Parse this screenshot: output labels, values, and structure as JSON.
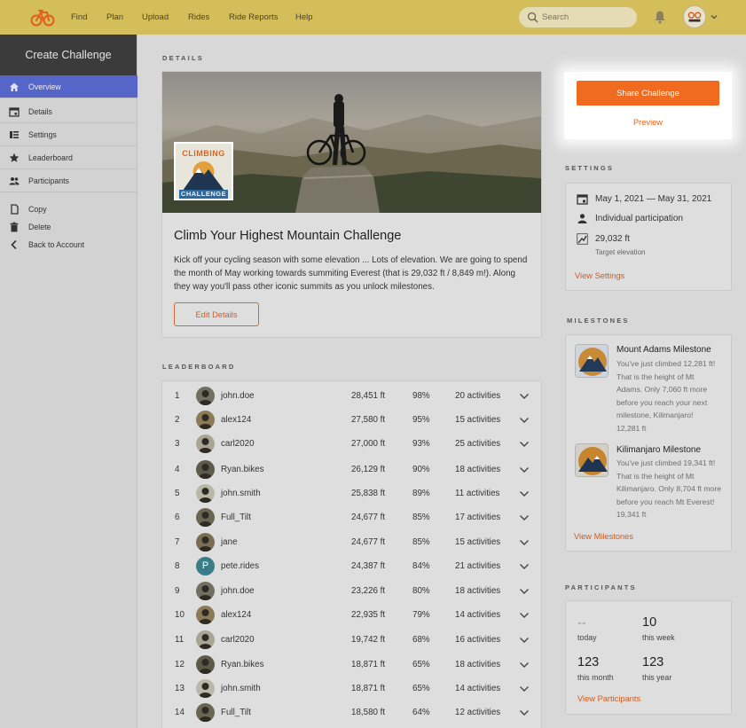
{
  "nav": {
    "items": [
      "Find",
      "Plan",
      "Upload",
      "Rides",
      "Ride Reports",
      "Help"
    ],
    "search_placeholder": "Search"
  },
  "sidebar": {
    "title": "Create Challenge",
    "items": [
      {
        "label": "Overview",
        "icon": "home-icon",
        "active": true
      },
      {
        "label": "Details",
        "icon": "calendar-icon"
      },
      {
        "label": "Settings",
        "icon": "settings-list-icon"
      },
      {
        "label": "Leaderboard",
        "icon": "star-icon"
      },
      {
        "label": "Participants",
        "icon": "people-icon"
      }
    ],
    "secondary": [
      {
        "label": "Copy",
        "icon": "copy-icon"
      },
      {
        "label": "Delete",
        "icon": "trash-icon"
      },
      {
        "label": "Back to Account",
        "icon": "chevron-left-icon"
      }
    ]
  },
  "details": {
    "section_label": "DETAILS",
    "badge_top": "CLIMBING",
    "badge_bottom": "CHALLENGE",
    "title": "Climb Your Highest Mountain Challenge",
    "description": "Kick off your cycling season with some elevation ... Lots of elevation. We are going to spend the month of May working towards summiting Everest (that is 29,032 ft / 8,849 m!). Along they way you'll pass other iconic summits as you unlock milestones.",
    "edit_label": "Edit Details"
  },
  "leaderboard": {
    "section_label": "LEADERBOARD",
    "rows": [
      {
        "rank": "1",
        "name": "john.doe",
        "elevation": "28,451 ft",
        "percent": "98%",
        "activities": "20 activities"
      },
      {
        "rank": "2",
        "name": "alex124",
        "elevation": "27,580 ft",
        "percent": "95%",
        "activities": "15 activities"
      },
      {
        "rank": "3",
        "name": "carl2020",
        "elevation": "27,000 ft",
        "percent": "93%",
        "activities": "25 activities"
      },
      {
        "rank": "4",
        "name": "Ryan.bikes",
        "elevation": "26,129 ft",
        "percent": "90%",
        "activities": "18 activities"
      },
      {
        "rank": "5",
        "name": "john.smith",
        "elevation": "25,838 ft",
        "percent": "89%",
        "activities": "11 activities"
      },
      {
        "rank": "6",
        "name": "Full_Tilt",
        "elevation": "24,677 ft",
        "percent": "85%",
        "activities": "17 activities"
      },
      {
        "rank": "7",
        "name": "jane",
        "elevation": "24,677 ft",
        "percent": "85%",
        "activities": "15 activities"
      },
      {
        "rank": "8",
        "name": "pete.rides",
        "elevation": "24,387 ft",
        "percent": "84%",
        "activities": "21 activities",
        "initial": "P"
      },
      {
        "rank": "9",
        "name": "john.doe",
        "elevation": "23,226 ft",
        "percent": "80%",
        "activities": "18 activities"
      },
      {
        "rank": "10",
        "name": "alex124",
        "elevation": "22,935 ft",
        "percent": "79%",
        "activities": "14 activities"
      },
      {
        "rank": "11",
        "name": "carl2020",
        "elevation": "19,742 ft",
        "percent": "68%",
        "activities": "16 activities"
      },
      {
        "rank": "12",
        "name": "Ryan.bikes",
        "elevation": "18,871 ft",
        "percent": "65%",
        "activities": "18 activities"
      },
      {
        "rank": "13",
        "name": "john.smith",
        "elevation": "18,871 ft",
        "percent": "65%",
        "activities": "14 activities"
      },
      {
        "rank": "14",
        "name": "Full_Tilt",
        "elevation": "18,580 ft",
        "percent": "64%",
        "activities": "12 activities"
      }
    ]
  },
  "actions": {
    "share_label": "Share Challenge",
    "preview_label": "Preview"
  },
  "settings": {
    "section_label": "SETTINGS",
    "dates": "May 1, 2021  —  May 31, 2021",
    "participation": "Individual participation",
    "target": "29,032 ft",
    "target_label": "Target elevation",
    "link": "View Settings"
  },
  "milestones": {
    "section_label": "MILESTONES",
    "items": [
      {
        "title": "Mount Adams Milestone",
        "line1": "You've just climbed 12,281 ft!",
        "line2": "That is the height of Mt",
        "line3": "Adams. Only 7,060 ft more",
        "line4": "before you reach your next",
        "line5": "milestone, Kilimanjaro!",
        "line6": "12,281 ft"
      },
      {
        "title": "Kilimanjaro Milestone",
        "line1": "You've just climbed 19,341 ft!",
        "line2": "That is the height of Mt",
        "line3": "Kilimanjaro. Only 8,704 ft more",
        "line4": "before you reach Mt Everest!",
        "line5": "19,341 ft"
      }
    ],
    "link": "View Milestones"
  },
  "participants": {
    "section_label": "PARTICIPANTS",
    "today_value": "--",
    "today_label": "today",
    "week_value": "10",
    "week_label": "this week",
    "month_value": "123",
    "month_label": "this month",
    "year_value": "123",
    "year_label": "this year",
    "link": "View Participants"
  },
  "colors": {
    "topbar": "#d4bd5b",
    "accent": "#f06a1f",
    "sidebar_active": "#5566c8"
  }
}
